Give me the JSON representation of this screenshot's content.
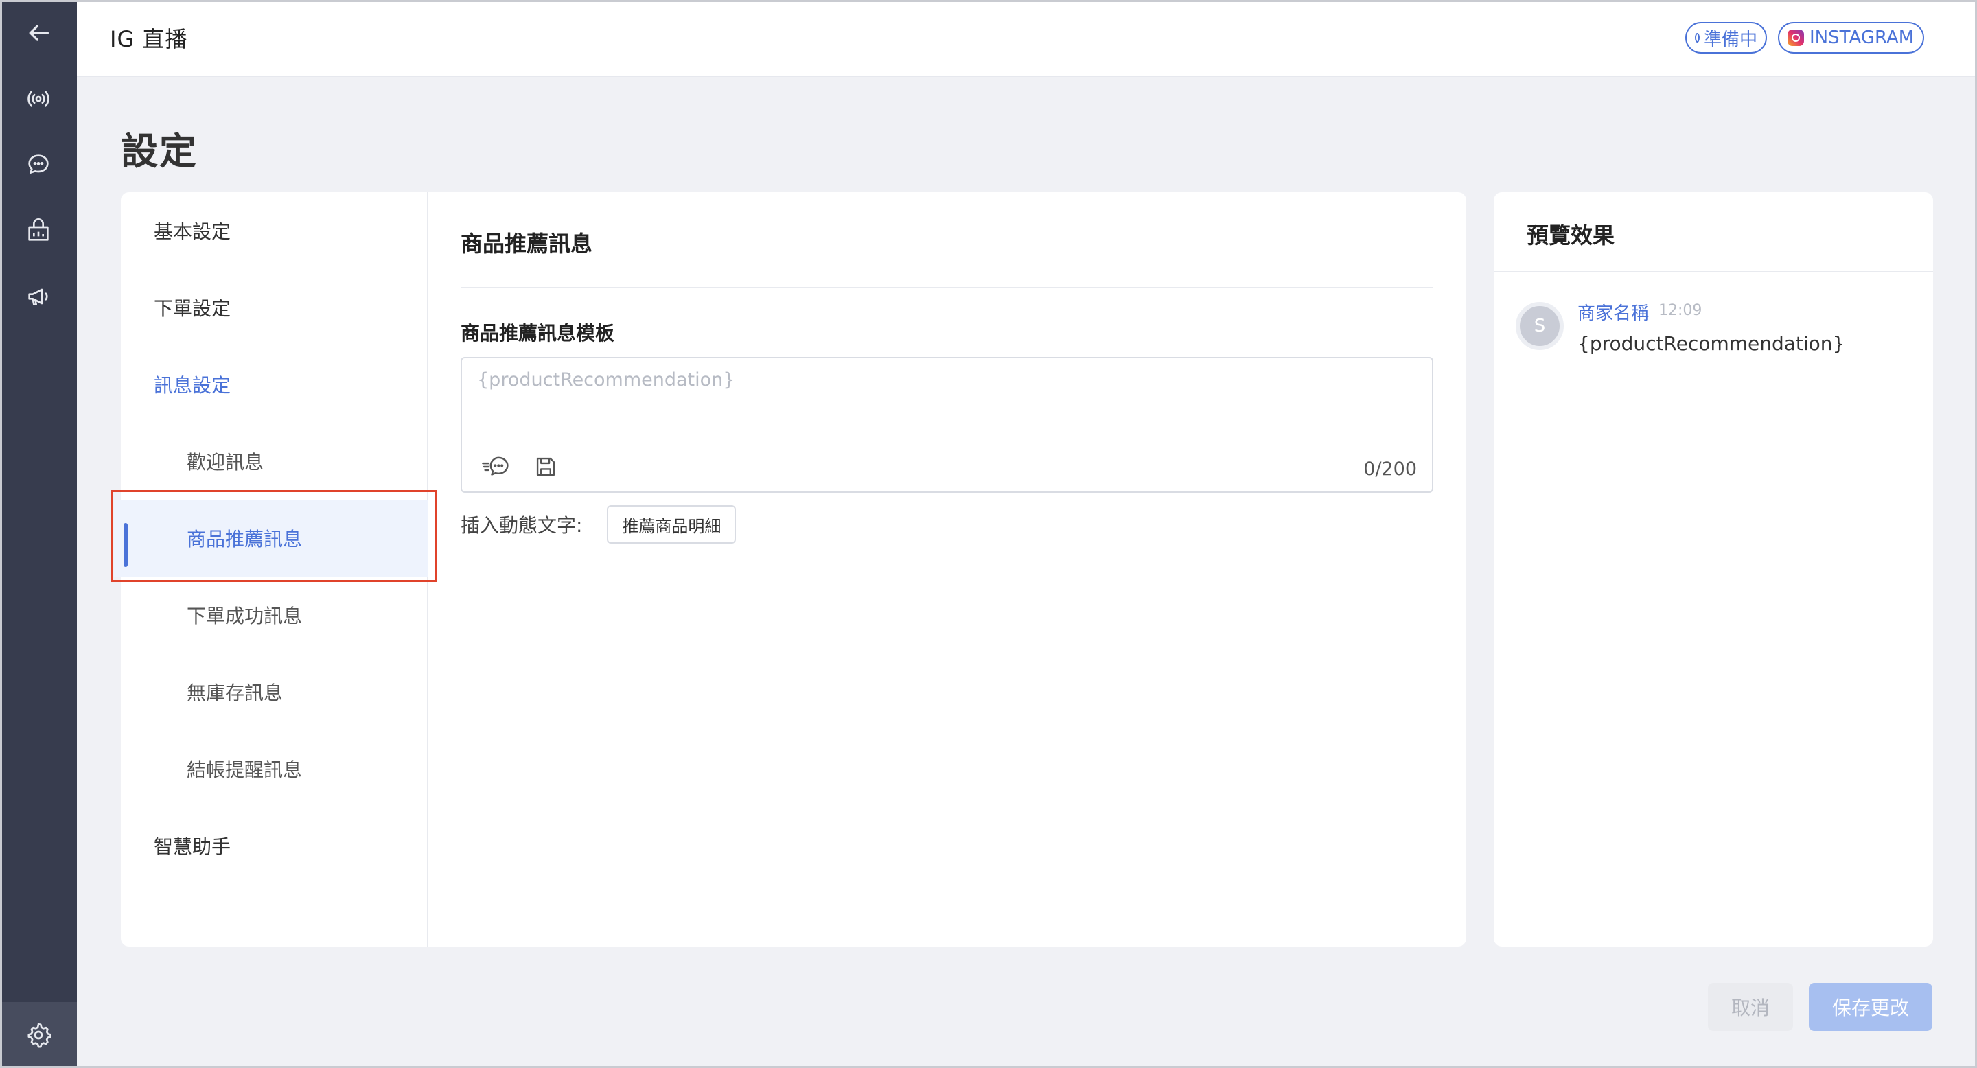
{
  "app": {
    "title": "IG 直播"
  },
  "header": {
    "status_badge": "準備中",
    "platform_badge": "INSTAGRAM"
  },
  "page": {
    "title": "設定"
  },
  "nav": {
    "items": [
      {
        "label": "基本設定",
        "level": "top"
      },
      {
        "label": "下單設定",
        "level": "top"
      },
      {
        "label": "訊息設定",
        "level": "top",
        "state": "expanded"
      },
      {
        "label": "歡迎訊息",
        "level": "sub"
      },
      {
        "label": "商品推薦訊息",
        "level": "sub",
        "state": "active"
      },
      {
        "label": "下單成功訊息",
        "level": "sub"
      },
      {
        "label": "無庫存訊息",
        "level": "sub"
      },
      {
        "label": "結帳提醒訊息",
        "level": "sub"
      },
      {
        "label": "智慧助手",
        "level": "top"
      }
    ]
  },
  "content": {
    "title": "商品推薦訊息",
    "template_label": "商品推薦訊息模板",
    "template_placeholder": "{productRecommendation}",
    "counter": "0/200",
    "insert_label": "插入動態文字:",
    "insert_button": "推薦商品明細"
  },
  "preview": {
    "title": "預覽效果",
    "avatar_initial": "S",
    "merchant_name": "商家名稱",
    "time": "12:09",
    "message": "{productRecommendation}"
  },
  "footer": {
    "cancel_label": "取消",
    "save_label": "保存更改"
  },
  "colors": {
    "accent": "#4a72d8",
    "rail": "#373c4e",
    "highlight": "#e0432b",
    "save_disabled": "#a7bff0"
  },
  "icons": {
    "rail": [
      "back-arrow-icon",
      "broadcast-icon",
      "chat-bubble-icon",
      "store-icon",
      "megaphone-icon",
      "gear-icon"
    ],
    "toolbar": [
      "quick-reply-icon",
      "save-template-icon"
    ]
  }
}
